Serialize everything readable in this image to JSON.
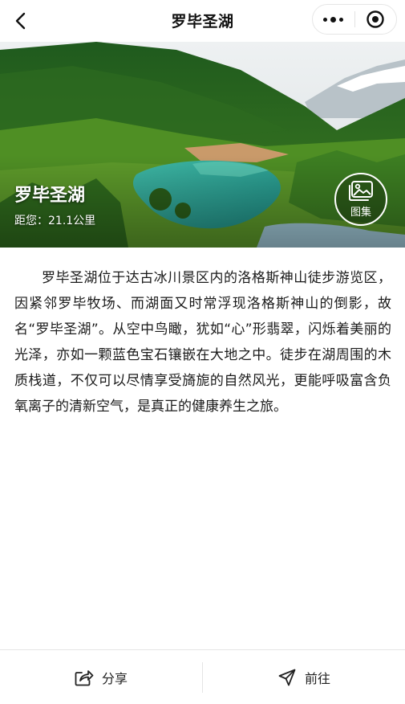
{
  "navbar": {
    "title": "罗毕圣湖"
  },
  "hero": {
    "title": "罗毕圣湖",
    "distance": "距您：21.1公里",
    "gallery_label": "图集"
  },
  "article": {
    "text": "罗毕圣湖位于达古冰川景区内的洛格斯神山徒步游览区，因紧邻罗毕牧场、而湖面又时常浮现洛格斯神山的倒影，故名“罗毕圣湖”。从空中鸟瞰，犹如“心”形翡翠，闪烁着美丽的光泽，亦如一颗蓝色宝石镶嵌在大地之中。徒步在湖周围的木质栈道，不仅可以尽情享受旖旎的自然风光，更能呼吸富含负氧离子的清新空气，是真正的健康养生之旅。"
  },
  "bottom_bar": {
    "share_label": "分享",
    "navigate_label": "前往"
  },
  "icons": [
    "back-arrow-icon",
    "more-dots-icon",
    "target-circle-icon",
    "image-gallery-icon",
    "share-icon",
    "navigation-arrow-icon"
  ]
}
